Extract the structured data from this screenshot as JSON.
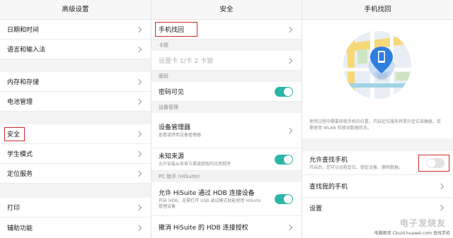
{
  "panel1": {
    "title": "高级设置",
    "items": [
      "日期和时间",
      "语言和输入法",
      "内存和存储",
      "电池管理",
      "安全",
      "学生模式",
      "定位服务",
      "打印",
      "辅助功能"
    ]
  },
  "panel2": {
    "title": "安全",
    "find_phone": "手机找回",
    "sim_section": "卡锁",
    "sim_lock": "设置卡 1/卡 2 卡锁",
    "password_section": "密码",
    "password_visible": "密码可见",
    "device_section": "设备管理",
    "device_manager": {
      "label": "设备管理器",
      "sub": "查看或停用设备管理器"
    },
    "unknown_sources": {
      "label": "未知来源",
      "sub": "允许安装从非官方渠道获取的应用程序"
    },
    "pc_section": "PC 助手 (HiSuite)",
    "allow_hdb": {
      "label": "允许 HiSuite 通过 HDB 连接设备",
      "sub": "开启 HDB，无需打开 USB 调试模式就能使用 HiSuite 管理设备"
    },
    "revoke_hdb": "撤消 HiSuite 的 HDB 连接授权"
  },
  "panel3": {
    "title": "手机找回",
    "description": "使用过程中需要获取手机的位置，开启定位服务将提升定位准确度。若需使用 WLAN 和移动数据状态。",
    "allow_find": {
      "label": "允许查找手机",
      "sub": "开启后，您可以远程定位、锁定设备、擦除数据。"
    },
    "find_my_phone": "查找我的手机",
    "settings": "设置"
  },
  "logo_text": "电子发烧友",
  "watermark": "电路图资 Cbuid.huawei.com 查找手机",
  "colors": {
    "toggle_on": "#2cb6a8",
    "highlight": "#d42a2a",
    "map_pin": "#2f7ee0"
  }
}
